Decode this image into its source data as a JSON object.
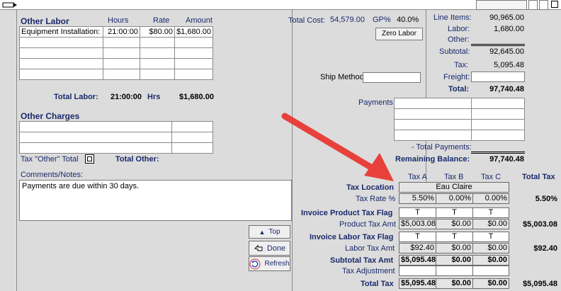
{
  "labor": {
    "section_title": "Other Labor",
    "col_hours": "Hours",
    "col_rate": "Rate",
    "col_amount": "Amount",
    "rows": [
      {
        "desc": "Equipment Installation:",
        "hours": "21:00:00",
        "rate": "$80.00",
        "amount": "$1,680.00"
      },
      {
        "desc": "",
        "hours": "",
        "rate": "",
        "amount": ""
      },
      {
        "desc": "",
        "hours": "",
        "rate": "",
        "amount": ""
      },
      {
        "desc": "",
        "hours": "",
        "rate": "",
        "amount": ""
      },
      {
        "desc": "",
        "hours": "",
        "rate": "",
        "amount": ""
      }
    ],
    "total_label": "Total Labor:",
    "total_hours": "21:00:00",
    "hrs_label": "Hrs",
    "total_amount": "$1,680.00"
  },
  "other_charges": {
    "title": "Other Charges",
    "tax_other_label": "Tax \"Other\" Total",
    "total_other_label": "Total Other:"
  },
  "comments": {
    "label": "Comments/Notes:",
    "text": "Payments are due within 30 days."
  },
  "cost": {
    "total_cost_label": "Total Cost:",
    "total_cost": "54,579.00",
    "gp_label": "GP%",
    "gp": "40.0%",
    "zero_labor_button": "Zero Labor"
  },
  "summary": {
    "line_items_label": "Line Items:",
    "line_items": "90,965.00",
    "labor_label": "Labor:",
    "labor": "1,680.00",
    "other_label": "Other:",
    "other": "",
    "subtotal_label": "Subtotal:",
    "subtotal": "92,645.00",
    "tax_label": "Tax:",
    "tax": "5,095.48",
    "freight_label": "Freight:",
    "freight": "",
    "total_label": "Total:",
    "total": "97,740.48",
    "ship_method_label": "Ship Method",
    "ship_method": ""
  },
  "payments": {
    "label": "Payments",
    "total_payments_label": "- Total Payments:",
    "total_payments": "",
    "remaining_label": "Remaining Balance:",
    "remaining": "97,740.48"
  },
  "tax_table": {
    "col_a": "Tax A",
    "col_b": "Tax B",
    "col_c": "Tax C",
    "col_total": "Total Tax",
    "location_label": "Tax Location",
    "location": "Eau Claire",
    "rate_label": "Tax Rate %",
    "rate_a": "5.50%",
    "rate_b": "0.00%",
    "rate_c": "0.00%",
    "rate_total": "5.50%",
    "inv_product_flag_label": "Invoice Product Tax Flag",
    "product_flag_a": "T",
    "product_flag_b": "T",
    "product_flag_c": "T",
    "product_amt_label": "Product Tax Amt",
    "product_a": "$5,003.08",
    "product_b": "$0.00",
    "product_c": "$0.00",
    "product_total": "$5,003.08",
    "inv_labor_flag_label": "Invoice Labor Tax Flag",
    "labor_flag_a": "T",
    "labor_flag_b": "T",
    "labor_flag_c": "T",
    "labor_amt_label": "Labor Tax Amt",
    "labor_a": "$92.40",
    "labor_b": "$0.00",
    "labor_c": "$0.00",
    "labor_total": "$92.40",
    "subtotal_amt_label": "Subtotal Tax Amt",
    "subtotal_a": "$5,095.48",
    "subtotal_b": "$0.00",
    "subtotal_c": "$0.00",
    "adjustment_label": "Tax Adjustment",
    "total_tax_label": "Total Tax",
    "total_a": "$5,095.48",
    "total_b": "$0.00",
    "total_c": "$0.00",
    "total_total": "$5,095.48"
  },
  "nav": {
    "top_label": "Top",
    "done_label": "Done",
    "refresh_label": "Refresh"
  },
  "colors": {
    "background": "#dcdcdc",
    "label_navy": "#1a2a6c",
    "arrow_red": "#e8413c"
  }
}
